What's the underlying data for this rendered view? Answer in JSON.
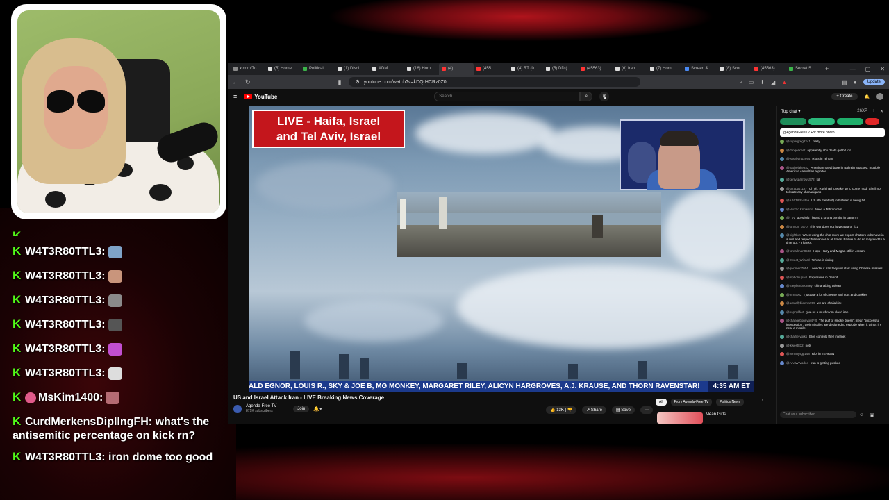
{
  "stream_chat": [
    {
      "user": "W4T3R80TTL3:",
      "text": "",
      "emote_color": "#7fa3c8"
    },
    {
      "user": "W4T3R80TTL3:",
      "text": "",
      "emote_color": "#c9957c"
    },
    {
      "user": "W4T3R80TTL3:",
      "text": "",
      "emote_color": "#8a8a8a"
    },
    {
      "user": "W4T3R80TTL3:",
      "text": "",
      "emote_color": "#555555"
    },
    {
      "user": "W4T3R80TTL3:",
      "text": "",
      "emote_color": "#c14fd0"
    },
    {
      "user": "W4T3R80TTL3:",
      "text": "",
      "emote_color": "#dddddd"
    },
    {
      "user": "MsKim1400:",
      "text": "",
      "emote_color": "#b56b73"
    },
    {
      "user": "CurdMerkensDiplIngFH:",
      "text": "what's the antisemitic percentage on kick rn?"
    },
    {
      "user": "W4T3R80TTL3:",
      "text": "iron dome too good"
    }
  ],
  "browser": {
    "tabs": [
      {
        "label": "x.com/7o",
        "color": "#888"
      },
      {
        "label": "(5) Home",
        "color": "#ddd"
      },
      {
        "label": "Political",
        "color": "#3bb34a"
      },
      {
        "label": "(1) Discl",
        "color": "#ddd"
      },
      {
        "label": "ADM",
        "color": "#ddd"
      },
      {
        "label": "(16) Hom",
        "color": "#ddd"
      },
      {
        "label": "(4)",
        "color": "#ff3333"
      },
      {
        "label": "(455",
        "color": "#ff3333"
      },
      {
        "label": "(4) RT (0",
        "color": "#ddd"
      },
      {
        "label": "(5) DD (",
        "color": "#ddd"
      },
      {
        "label": "(45563)",
        "color": "#ff3333"
      },
      {
        "label": "(6) Iran",
        "color": "#ddd"
      },
      {
        "label": "(7) Hom",
        "color": "#ddd"
      },
      {
        "label": "Screen &",
        "color": "#4a8af4"
      },
      {
        "label": "(8) Scor",
        "color": "#ddd"
      },
      {
        "label": "(45563)",
        "color": "#ff3333"
      },
      {
        "label": "Secret S",
        "color": "#3bb34a"
      }
    ],
    "url": "youtube.com/watch?v=kDQrHCRz0Z0",
    "update_label": "Update"
  },
  "youtube": {
    "logo": "YouTube",
    "search_placeholder": "Search",
    "create_label": "+ Create",
    "video_title": "US and Israel Attack Iran - LIVE Breaking News Coverage",
    "channel_name": "Agenda-Free TV",
    "subscribers": "871K subscribers",
    "join_label": "Join",
    "likes": "13K",
    "share_label": "Share",
    "save_label": "Save",
    "rec_tabs": [
      "All",
      "From Agenda-Free TV",
      "Politics News"
    ],
    "rec_title": "Mean Girls"
  },
  "video": {
    "live_line1": "LIVE - Haifa, Israel",
    "live_line2": "and Tel Aviv, Israel",
    "ticker": "ALD EGNOR, LOUIS R., SKY & JOE B, MG MONKEY, MARGARET RILEY, ALICYN HARGROVES, A.J. KRAUSE, AND THORN RAVENSTAR!",
    "time": "4:35 AM ET"
  },
  "livechat": {
    "header": "Top chat",
    "count": "26XP",
    "pinned": "@AgendaFreeTV  For more photo",
    "messages": [
      {
        "user": "@supergreg2241",
        "text": "crazy"
      },
      {
        "user": "@GingerKent",
        "text": "apparently abu dhabi got hit too"
      },
      {
        "user": "@easyliving2994",
        "text": "Riots in Tehran"
      },
      {
        "user": "@nativejake932",
        "text": "American naval base in Bahrain attacked, multiple American casualties reported."
      },
      {
        "user": "@kerrysparrow1572",
        "text": "lol"
      },
      {
        "user": "@scrappy1127",
        "text": "Uh oh. Ruth had to wake up to come mod. She'll not tolerate any shenanigans"
      },
      {
        "user": "@ABCDEF-Idea",
        "text": "US 5th Fleet HQ in Bahrain is being hit"
      },
      {
        "user": "@Nunzio Knowsno",
        "text": "Need a Tehran cam."
      },
      {
        "user": "@l_vy",
        "text": "guys iolg I heard a strong bomba in qatar rn"
      },
      {
        "user": "@jonnon_1970",
        "text": "This war does not have aura or rizz"
      },
      {
        "user": "@nightbot",
        "text": "When using the chat room we expect chatters to behave in a civil and respectful manner at all times. Failure to do so may lead to a time out. - Thanks."
      },
      {
        "user": "@foreallman8533",
        "text": "Hope Harry and Megan still in Jordan"
      },
      {
        "user": "@Sweet_Wizard",
        "text": "Tehran is rioting"
      },
      {
        "user": "@gwomen7054",
        "text": "I wonder if Iran they will start using Chinese missiles"
      },
      {
        "user": "@mpholsupaul",
        "text": "Explosions in Detroit"
      },
      {
        "user": "@Stephenbourney",
        "text": "china taking taiwan"
      },
      {
        "user": "@mrn4062",
        "text": "I just ate a lot of cheese and nuts and cookies"
      },
      {
        "user": "@actuallybidenw999",
        "text": "we are chalia kirk"
      },
      {
        "user": "@happylife4",
        "text": "give us a mushroom cloud iran"
      },
      {
        "user": "@changebonnyoutFilt",
        "text": "The puff of smoke doesn't mean 'successful interception', their missiles are designed to explode when it thinks it's near a missile."
      },
      {
        "user": "@charlie-yorks",
        "text": "Elon controls their internet"
      },
      {
        "user": "@jkwest832",
        "text": "riots"
      },
      {
        "user": "@Jonnnysgg148",
        "text": "Riot in TEHRAN"
      },
      {
        "user": "@AAAW-Vodoo",
        "text": "Iran is getting pushed"
      }
    ],
    "input_placeholder": "Chat as a subscriber..."
  }
}
